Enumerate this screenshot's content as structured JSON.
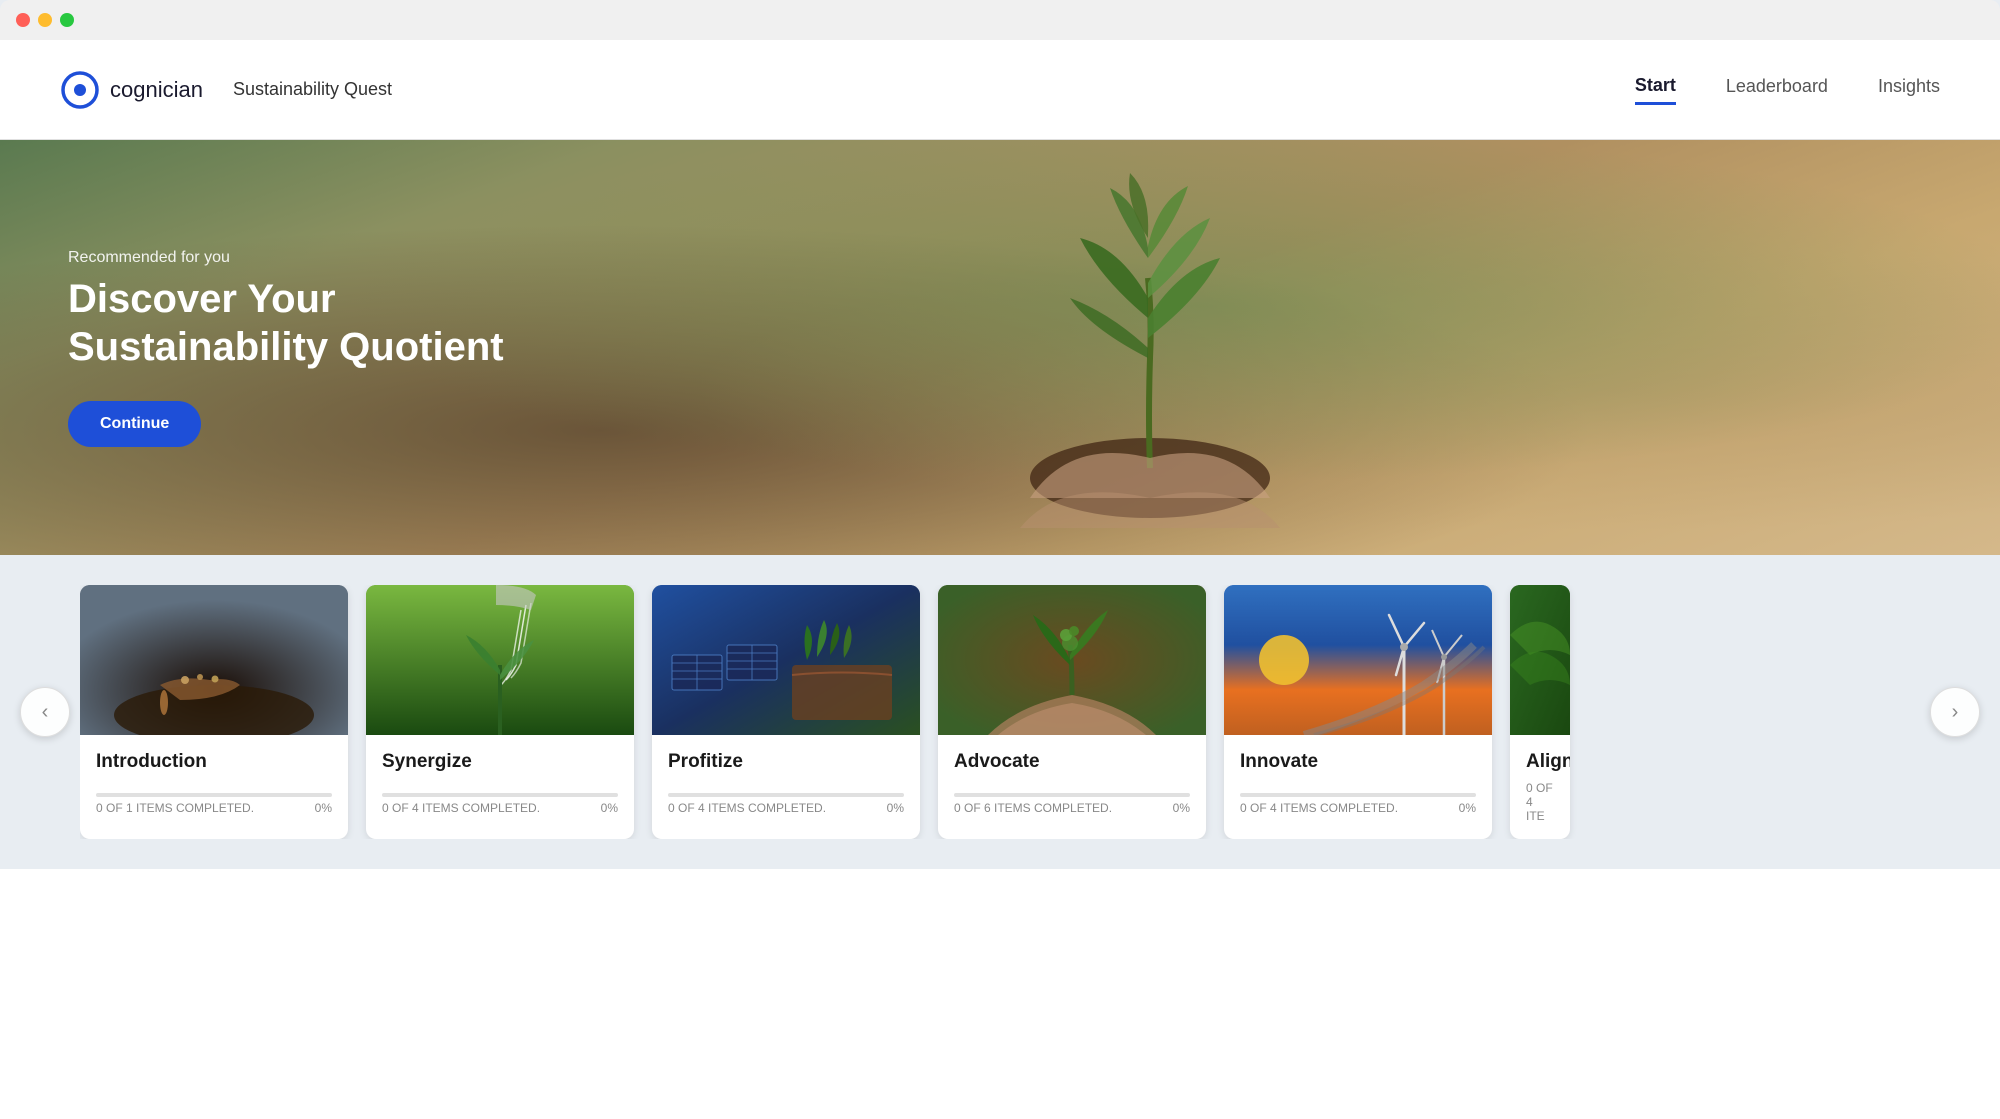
{
  "window": {
    "title": "Sustainability Quest"
  },
  "header": {
    "logo_text": "cognician",
    "app_title": "Sustainability Quest",
    "nav": {
      "items": [
        {
          "label": "Start",
          "active": true
        },
        {
          "label": "Leaderboard",
          "active": false
        },
        {
          "label": "Insights",
          "active": false
        }
      ]
    }
  },
  "hero": {
    "recommended_label": "Recommended for you",
    "title": "Discover Your Sustainability Quotient",
    "button_label": "Continue"
  },
  "cards": {
    "left_arrow": "‹",
    "right_arrow": "›",
    "items": [
      {
        "id": "introduction",
        "title": "Introduction",
        "progress_percent": "0%",
        "items_completed": "0 OF 1 ITEMS COMPLETED.",
        "img_class": "card-img-intro"
      },
      {
        "id": "synergize",
        "title": "Synergize",
        "progress_percent": "0%",
        "items_completed": "0 OF 4 ITEMS COMPLETED.",
        "img_class": "card-img-synergize"
      },
      {
        "id": "profitize",
        "title": "Profitize",
        "progress_percent": "0%",
        "items_completed": "0 OF 4 ITEMS COMPLETED.",
        "img_class": "card-img-profitize"
      },
      {
        "id": "advocate",
        "title": "Advocate",
        "progress_percent": "0%",
        "items_completed": "0 OF 6 ITEMS COMPLETED.",
        "img_class": "card-img-advocate"
      },
      {
        "id": "innovate",
        "title": "Innovate",
        "progress_percent": "0%",
        "items_completed": "0 OF 4 ITEMS COMPLETED.",
        "img_class": "card-img-innovate"
      }
    ],
    "partial_item": {
      "title": "Align",
      "items_completed": "0 OF 4 ITE",
      "img_class": "card-img-align"
    }
  }
}
